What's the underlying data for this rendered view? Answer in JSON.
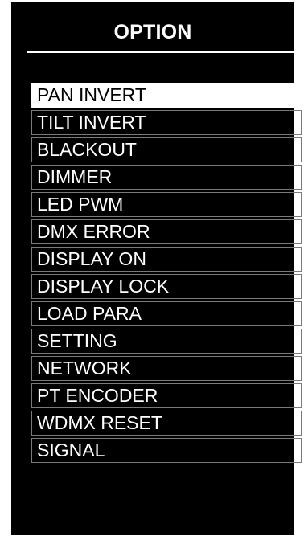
{
  "header": {
    "title": "OPTION"
  },
  "colors": {
    "background": "#000000",
    "text": "#ffffff",
    "selected_background": "#ffffff",
    "selected_text": "#000000"
  },
  "menu": {
    "selected_index": 0,
    "items": [
      {
        "label": "PAN INVERT"
      },
      {
        "label": "TILT INVERT"
      },
      {
        "label": "BLACKOUT"
      },
      {
        "label": "DIMMER"
      },
      {
        "label": "LED PWM"
      },
      {
        "label": "DMX ERROR"
      },
      {
        "label": "DISPLAY ON"
      },
      {
        "label": "DISPLAY LOCK"
      },
      {
        "label": "LOAD PARA"
      },
      {
        "label": "SETTING"
      },
      {
        "label": "NETWORK"
      },
      {
        "label": "PT ENCODER"
      },
      {
        "label": "WDMX RESET"
      },
      {
        "label": "SIGNAL"
      }
    ]
  }
}
